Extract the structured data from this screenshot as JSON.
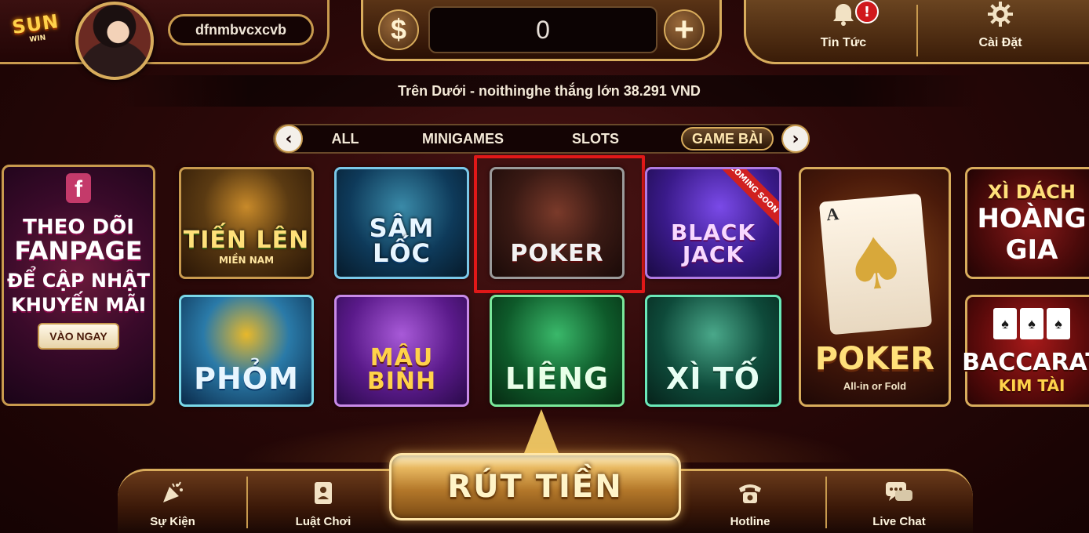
{
  "header": {
    "logo_text": "SUN",
    "logo_sub": "WIN",
    "username": "dfnmbvcxcvb",
    "currency_icon": "$",
    "balance": "0",
    "topup_icon": "+",
    "news_label": "Tin Tức",
    "news_badge": "!",
    "settings_label": "Cài Đặt"
  },
  "marquee": {
    "text": "Trên Dưới - noithinghe thắng lớn 38.291 VND"
  },
  "tabs": {
    "items": [
      {
        "label": "ALL"
      },
      {
        "label": "MINIGAMES"
      },
      {
        "label": "SLOTS"
      },
      {
        "label": "GAME BÀI"
      }
    ],
    "active_index": 3
  },
  "promo": {
    "fb_icon": "f",
    "line1": "THEO DÕI",
    "line2": "FANPAGE",
    "line3": "ĐỂ CẬP NHẬT",
    "line4": "KHUYẾN MÃI",
    "button": "VÀO NGAY"
  },
  "games": {
    "tienlen": {
      "title": "TIẾN LÊN",
      "sub": "MIỀN NAM"
    },
    "samloc": {
      "title": "SÂM LỐC"
    },
    "poker": {
      "title": "POKER"
    },
    "blackjack": {
      "title": "BLACK JACK",
      "ribbon": "COMING SOON"
    },
    "phom": {
      "title": "PHỎM"
    },
    "maubinh": {
      "title": "MẬU BINH"
    },
    "lieng": {
      "title": "LIÊNG"
    },
    "xito": {
      "title": "XÌ TỐ"
    },
    "poker_allin": {
      "title": "POKER",
      "sub": "All-in or Fold",
      "card_rank": "A",
      "card_suit": "♠"
    },
    "xidach": {
      "line1": "XÌ DÁCH",
      "line2": "HOÀNG",
      "line3": "GIA"
    },
    "baccarat": {
      "line1": "BACCARAT",
      "line2": "KIM TÀI"
    }
  },
  "bottom": {
    "event_label": "Sự Kiện",
    "rules_label": "Luật Chơi",
    "withdraw_label": "RÚT TIỀN",
    "hotline_label": "Hotline",
    "livechat_label": "Live Chat"
  },
  "colors": {
    "gold_border": "#d8ac5c",
    "highlight": "#e01818",
    "background": "#2a0808"
  },
  "icons": {
    "news": "bell-icon",
    "settings": "gear-icon",
    "event": "party-popper-icon",
    "rules": "rulebook-icon",
    "hotline": "telephone-icon",
    "livechat": "chat-bubbles-icon"
  }
}
